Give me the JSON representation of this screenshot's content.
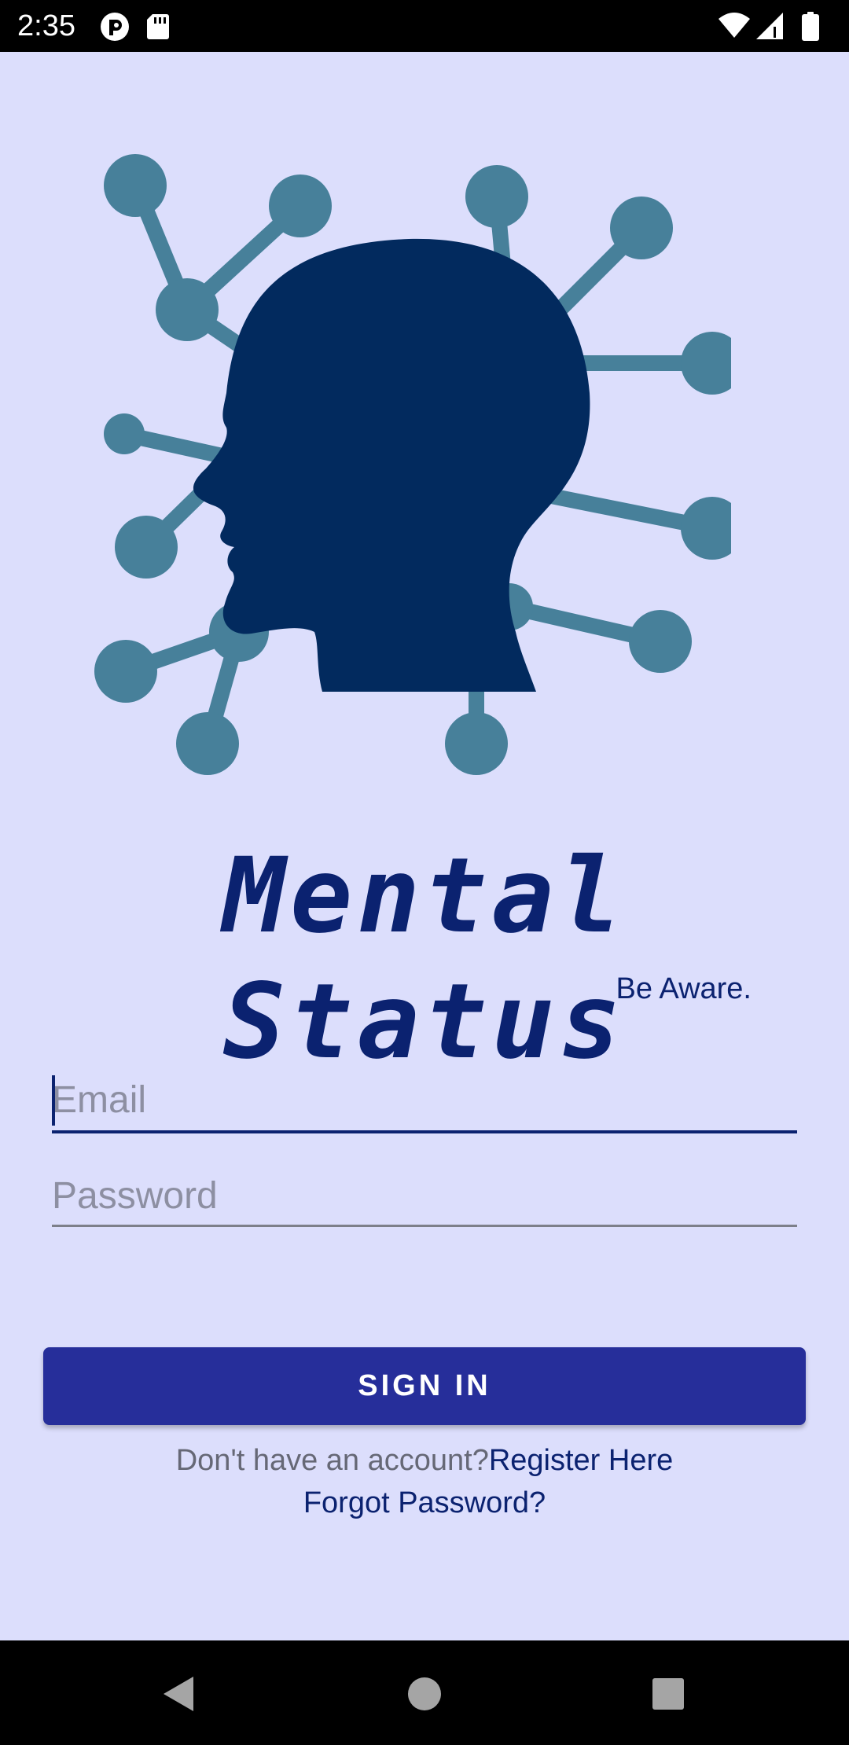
{
  "status_bar": {
    "time": "2:35"
  },
  "icons": {
    "status_left": [
      "notification-icon",
      "sd-card-icon"
    ],
    "status_right": [
      "wifi-icon",
      "signal-icon",
      "battery-icon"
    ],
    "nav": [
      "back-icon",
      "home-icon",
      "recents-icon"
    ]
  },
  "app": {
    "title": "Mental Status",
    "tagline": "Be Aware."
  },
  "form": {
    "email_placeholder": "Email",
    "password_placeholder": "Password",
    "signin_label": "SIGN IN",
    "no_account_text": "Don't have an account?",
    "register_label": "Register Here",
    "forgot_label": "Forgot Password?"
  },
  "colors": {
    "background": "#dcdefc",
    "primary": "#262e9a",
    "title": "#0b2270",
    "logo_head": "#022a5e",
    "logo_network": "#47809a"
  }
}
